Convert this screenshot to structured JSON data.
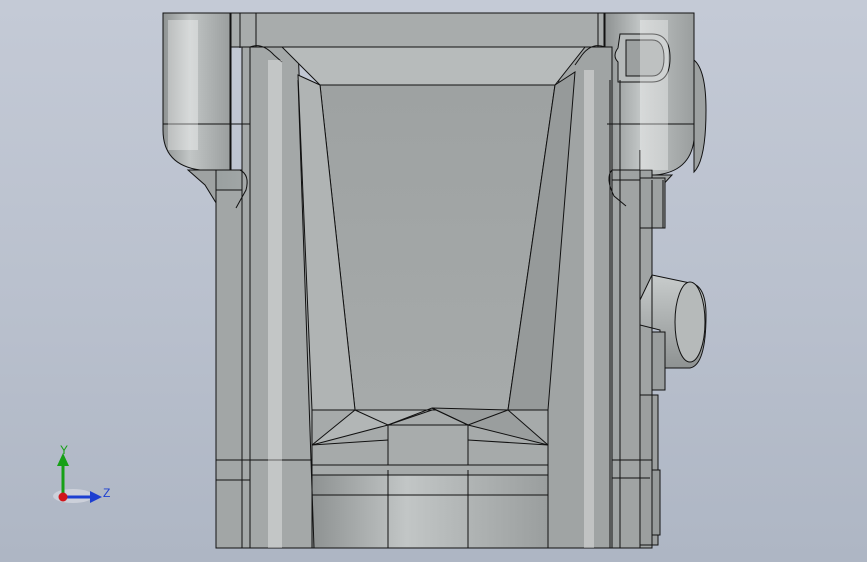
{
  "viewport": {
    "background_top": "#c4cad6",
    "background_bottom": "#aeb6c4"
  },
  "model": {
    "body_color": "#a9adad",
    "dark_face_color": "#8f9393",
    "light_face_color": "#c3c7c7",
    "edge_color": "#000000"
  },
  "triad": {
    "y_label": "Y",
    "z_label": "Z",
    "y_color": "#16a016",
    "z_color": "#1d3fd1",
    "x_color": "#d0151a"
  }
}
